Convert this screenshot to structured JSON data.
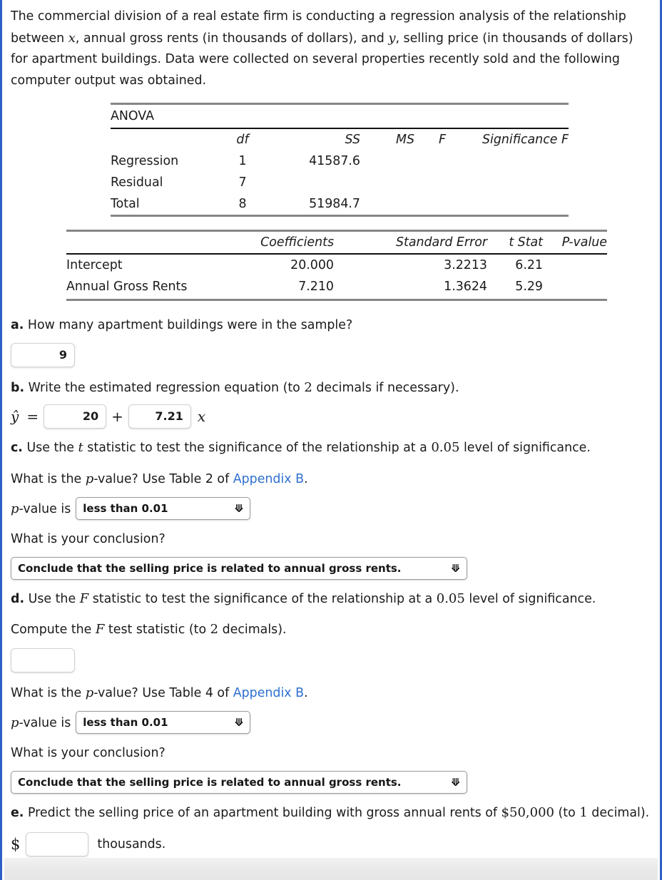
{
  "problem": {
    "intro": "The commercial division of a real estate firm is conducting a regression analysis of the relationship between ",
    "intro_x": "x",
    "intro_mid": ", annual gross rents (in thousands of dollars), and ",
    "intro_y": "y",
    "intro_end": ", selling price (in thousands of dollars) for apartment buildings. Data were collected on several properties recently sold and the following computer output was obtained."
  },
  "anova": {
    "title": "ANOVA",
    "headers": [
      "",
      "df",
      "SS",
      "MS",
      "F",
      "Significance F"
    ],
    "rows": [
      {
        "label": "Regression",
        "df": "1",
        "ss": "41587.6",
        "ms": "",
        "f": "",
        "sigf": ""
      },
      {
        "label": "Residual",
        "df": "7",
        "ss": "",
        "ms": "",
        "f": "",
        "sigf": ""
      },
      {
        "label": "Total",
        "df": "8",
        "ss": "51984.7",
        "ms": "",
        "f": "",
        "sigf": ""
      }
    ]
  },
  "coefficients": {
    "headers": [
      "",
      "Coefficients",
      "Standard Error",
      "t Stat",
      "P-value"
    ],
    "rows": [
      {
        "label": "Intercept",
        "coef": "20.000",
        "se": "3.2213",
        "tstat": "6.21",
        "pvalue": ""
      },
      {
        "label": "Annual Gross Rents",
        "coef": "7.210",
        "se": "1.3624",
        "tstat": "5.29",
        "pvalue": ""
      }
    ]
  },
  "part_a": {
    "marker": "a.",
    "question": "How many apartment buildings were in the sample?",
    "answer_value": "9"
  },
  "part_b": {
    "marker": "b.",
    "question_pre": "Write the estimated regression equation (to ",
    "question_num": "2",
    "question_post": " decimals if necessary).",
    "lhs": "ŷ",
    "equals": "=",
    "intercept_value": "20",
    "plus": "+",
    "slope_value": "7.21",
    "x_symbol": "x"
  },
  "part_c": {
    "marker": "c.",
    "line1_pre": "Use the ",
    "line1_stat": "t",
    "line1_mid": " statistic to test the significance of the relationship at a ",
    "line1_alpha": "0.05",
    "line1_post": " level of significance.",
    "line2_pre": "What is the ",
    "line2_p": "p",
    "line2_mid": "-value? Use Table 2 of ",
    "line2_link": "Appendix B",
    "line2_post": ".",
    "pvalue_label_p": "p",
    "pvalue_label_rest": "-value is",
    "pvalue_selected": "less than 0.01",
    "conclusion_question": "What is your conclusion?",
    "conclusion_selected": "Conclude that the selling price is related to annual gross rents."
  },
  "part_d": {
    "marker": "d.",
    "line1_pre": "Use the ",
    "line1_stat": "F",
    "line1_mid": " statistic to test the significance of the relationship at a ",
    "line1_alpha": "0.05",
    "line1_post": " level of significance.",
    "line2_pre": "Compute the ",
    "line2_stat": "F",
    "line2_mid": " test statistic (to ",
    "line2_num": "2",
    "line2_post": " decimals).",
    "fstat_value": "",
    "line3_pre": "What is the ",
    "line3_p": "p",
    "line3_mid": "-value? Use Table 4 of ",
    "line3_link": "Appendix B",
    "line3_post": ".",
    "pvalue_label_p": "p",
    "pvalue_label_rest": "-value is",
    "pvalue_selected": "less than 0.01",
    "conclusion_question": "What is your conclusion?",
    "conclusion_selected": "Conclude that the selling price is related to annual gross rents."
  },
  "part_e": {
    "marker": "e.",
    "question_pre": "Predict the selling price of an apartment building with gross annual rents of ",
    "question_amount": "$50,000",
    "question_mid": " (to ",
    "question_num": "1",
    "question_post": " decimal).",
    "dollar_sign": "$",
    "answer_value": "",
    "units": "thousands."
  },
  "icons": {
    "chevron_down": "❯"
  },
  "colors": {
    "page_border": "#2f5fc4",
    "link": "#2f6fd0",
    "rule_gray": "#868686",
    "rule_dark": "#111111",
    "text": "#1b1b1b"
  }
}
